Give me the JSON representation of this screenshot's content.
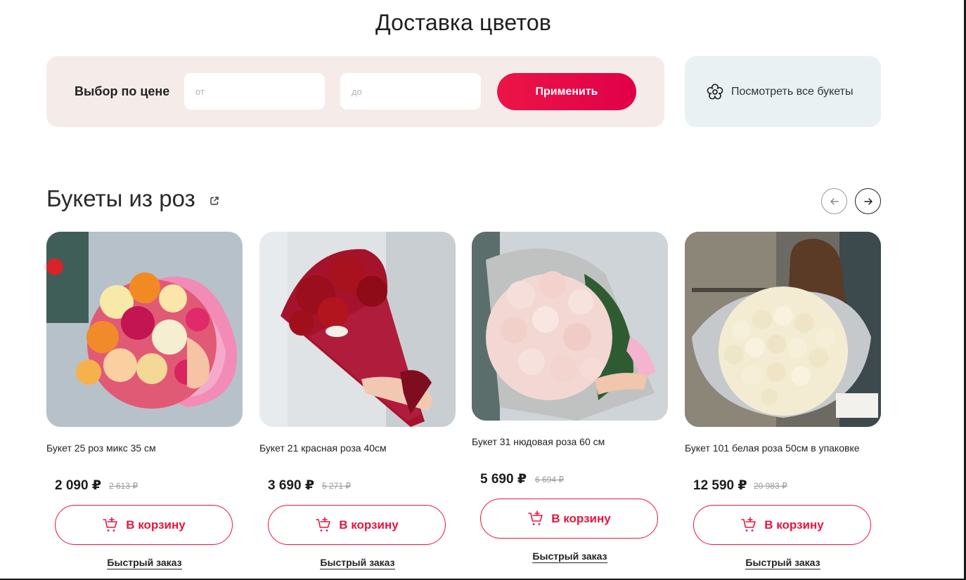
{
  "page": {
    "title": "Доставка цветов"
  },
  "price_filter": {
    "label": "Выбор по цене",
    "from_placeholder": "от",
    "to_placeholder": "до",
    "apply_label": "Применить"
  },
  "all_bouquets": {
    "label": "Посмотреть все букеты",
    "icon": "flower-icon"
  },
  "section": {
    "title": "Букеты из роз",
    "link_icon": "external-link-icon",
    "prev_icon": "arrow-left-icon",
    "next_icon": "arrow-right-icon"
  },
  "products": [
    {
      "name": "Букет 25 роз микс 35 см",
      "price": "2 090 ₽",
      "old_price": "2 613 ₽",
      "cart_label": "В корзину",
      "quick_label": "Быстрый заказ"
    },
    {
      "name": "Букет 21 красная роза 40см",
      "price": "3 690 ₽",
      "old_price": "5 271 ₽",
      "cart_label": "В корзину",
      "quick_label": "Быстрый заказ"
    },
    {
      "name": "Букет 31 нюдовая роза 60 см",
      "price": "5 690 ₽",
      "old_price": "6 694 ₽",
      "cart_label": "В корзину",
      "quick_label": "Быстрый заказ"
    },
    {
      "name": "Букет 101 белая роза 50см в упаковке",
      "price": "12 590 ₽",
      "old_price": "20 983 ₽",
      "cart_label": "В корзину",
      "quick_label": "Быстрый заказ"
    }
  ],
  "colors": {
    "accent": "#e8163f",
    "filter_bg": "#f5ecea",
    "all_bouquets_bg": "#e9f1f3"
  }
}
